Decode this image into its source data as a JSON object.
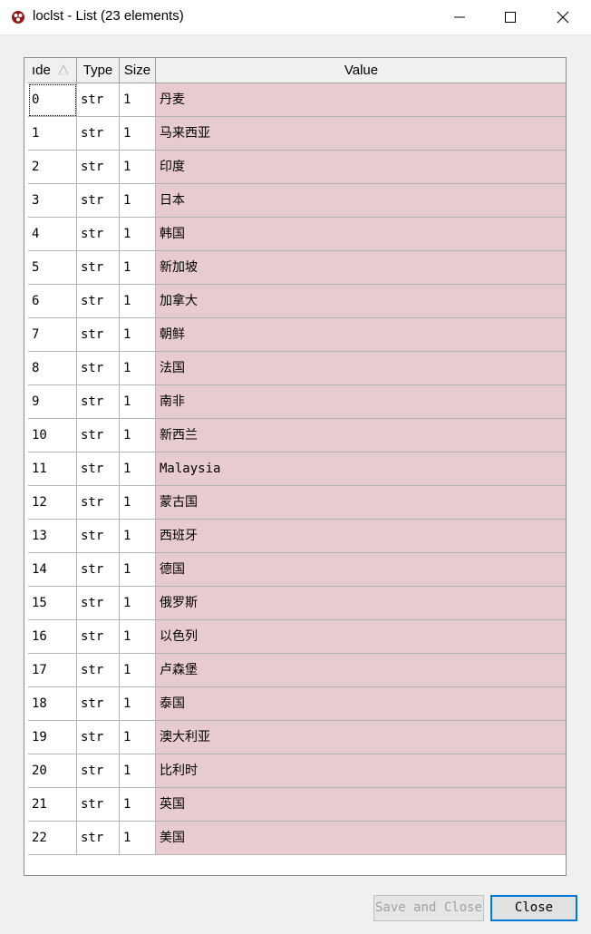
{
  "window": {
    "title": "loclst - List (23 elements)",
    "icon": "spyder-icon"
  },
  "table": {
    "columns": [
      "ıde",
      "Type",
      "Size",
      "Value"
    ],
    "sort_indicator": "ascending",
    "rows": [
      {
        "index": "0",
        "type": "str",
        "size": "1",
        "value": "丹麦"
      },
      {
        "index": "1",
        "type": "str",
        "size": "1",
        "value": "马来西亚"
      },
      {
        "index": "2",
        "type": "str",
        "size": "1",
        "value": "印度"
      },
      {
        "index": "3",
        "type": "str",
        "size": "1",
        "value": "日本"
      },
      {
        "index": "4",
        "type": "str",
        "size": "1",
        "value": "韩国"
      },
      {
        "index": "5",
        "type": "str",
        "size": "1",
        "value": "新加坡"
      },
      {
        "index": "6",
        "type": "str",
        "size": "1",
        "value": "加拿大"
      },
      {
        "index": "7",
        "type": "str",
        "size": "1",
        "value": "朝鲜"
      },
      {
        "index": "8",
        "type": "str",
        "size": "1",
        "value": "法国"
      },
      {
        "index": "9",
        "type": "str",
        "size": "1",
        "value": "南非"
      },
      {
        "index": "10",
        "type": "str",
        "size": "1",
        "value": "新西兰"
      },
      {
        "index": "11",
        "type": "str",
        "size": "1",
        "value": "Malaysia"
      },
      {
        "index": "12",
        "type": "str",
        "size": "1",
        "value": "蒙古国"
      },
      {
        "index": "13",
        "type": "str",
        "size": "1",
        "value": "西班牙"
      },
      {
        "index": "14",
        "type": "str",
        "size": "1",
        "value": "德国"
      },
      {
        "index": "15",
        "type": "str",
        "size": "1",
        "value": "俄罗斯"
      },
      {
        "index": "16",
        "type": "str",
        "size": "1",
        "value": "以色列"
      },
      {
        "index": "17",
        "type": "str",
        "size": "1",
        "value": "卢森堡"
      },
      {
        "index": "18",
        "type": "str",
        "size": "1",
        "value": "泰国"
      },
      {
        "index": "19",
        "type": "str",
        "size": "1",
        "value": "澳大利亚"
      },
      {
        "index": "20",
        "type": "str",
        "size": "1",
        "value": "比利时"
      },
      {
        "index": "21",
        "type": "str",
        "size": "1",
        "value": "英国"
      },
      {
        "index": "22",
        "type": "str",
        "size": "1",
        "value": "美国"
      }
    ]
  },
  "buttons": {
    "save_and_close": "Save and Close",
    "close": "Close"
  },
  "colors": {
    "value_cell_bg": "#e8cbce",
    "focus_border": "#0078d7"
  }
}
